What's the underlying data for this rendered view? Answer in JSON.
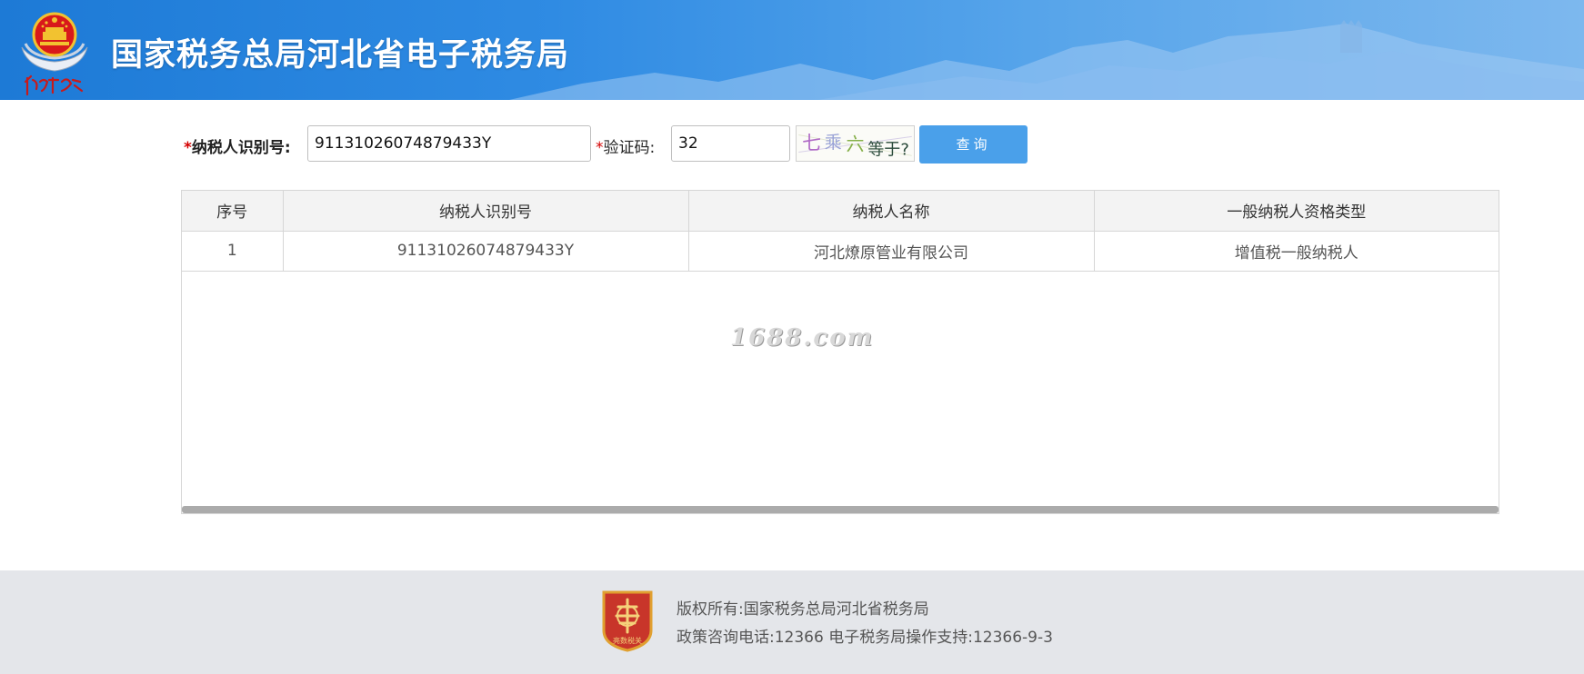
{
  "header": {
    "title": "国家税务总局河北省电子税务局",
    "emblem_caption": "中国税务",
    "colors": {
      "banner_start": "#1d7ad6",
      "banner_end": "#7db8ee"
    }
  },
  "search": {
    "required_mark": "*",
    "taxid_label": "纳税人识别号:",
    "taxid_value": "91131026074879433Y",
    "captcha_label": "验证码:",
    "captcha_value": "32",
    "captcha_image_text": [
      "七",
      "乘",
      "六",
      "等于?"
    ],
    "query_button": "查询",
    "colors": {
      "button": "#4aa0ea",
      "required": "#d40000"
    }
  },
  "results": {
    "columns": [
      "序号",
      "纳税人识别号",
      "纳税人名称",
      "一般纳税人资格类型"
    ],
    "rows": [
      {
        "index": "1",
        "taxid": "91131026074879433Y",
        "name": "河北燎原管业有限公司",
        "qualification": "增值税一般纳税人"
      }
    ],
    "watermark": "1688.com"
  },
  "footer": {
    "logo_caption": "亮数税关",
    "copyright": "版权所有:国家税务总局河北省税务局",
    "contact": "政策咨询电话:12366 电子税务局操作支持:12366-9-3"
  }
}
